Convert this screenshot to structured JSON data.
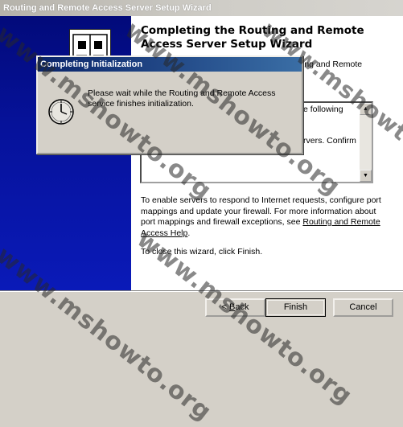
{
  "window": {
    "title": "Routing and Remote Access Server Setup Wizard"
  },
  "heading": "Completing the Routing and Remote Access Server Setup Wizard",
  "intro_fragment": "ing and Remote",
  "summary": {
    "line1_fragment": "e following",
    "line2_fragment": "rvers. Confirm"
  },
  "instructions": {
    "text": "To enable servers to respond to Internet requests, configure port mappings and update your firewall. For more information about port mappings and firewall exceptions, see",
    "link": "Routing and Remote Access Help",
    "after_link": "."
  },
  "close_text": "To close this wizard, click Finish.",
  "buttons": {
    "back_prefix": "< ",
    "back_underlined": "B",
    "back_suffix": "ack",
    "finish": "Finish",
    "cancel": "Cancel"
  },
  "dialog": {
    "title": "Completing Initialization",
    "message": "Please wait while the Routing and Remote Access service finishes initialization."
  },
  "watermark": {
    "text": "www.mshowto.org"
  },
  "icons": {
    "wizard": "network-book-icon",
    "dialog": "clock-icon"
  }
}
